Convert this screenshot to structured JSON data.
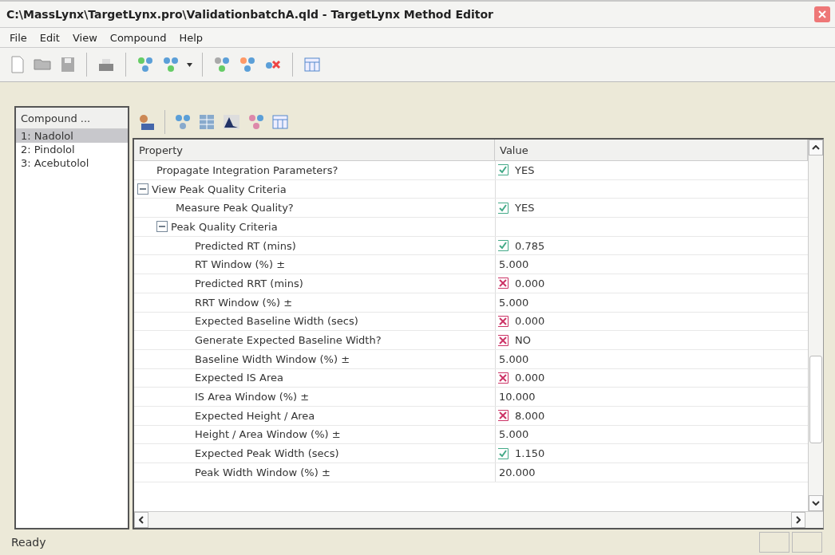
{
  "window": {
    "title": "C:\\MassLynx\\TargetLynx.pro\\ValidationbatchA.qld - TargetLynx Method Editor"
  },
  "menu": [
    "File",
    "Edit",
    "View",
    "Compound",
    "Help"
  ],
  "compounds": {
    "header": "Compound ...",
    "items": [
      {
        "label": "1: Nadolol",
        "selected": true
      },
      {
        "label": "2: Pindolol",
        "selected": false
      },
      {
        "label": "3: Acebutolol",
        "selected": false
      }
    ]
  },
  "grid": {
    "columns": [
      "Property",
      "Value"
    ],
    "rows": [
      {
        "label": "Propagate Integration Parameters?",
        "kind": "toggle",
        "enabled": true,
        "value": "YES"
      },
      {
        "label": "View Peak Quality Criteria",
        "kind": "group",
        "expanded": true,
        "children": [
          {
            "label": "Measure Peak Quality?",
            "kind": "toggle",
            "enabled": true,
            "value": "YES"
          },
          {
            "label": "Peak Quality Criteria",
            "kind": "group",
            "expanded": true,
            "children": [
              {
                "label": "Predicted RT (mins)",
                "kind": "toggle",
                "enabled": true,
                "value": "0.785"
              },
              {
                "label": "RT Window (%) ±",
                "kind": "plain",
                "value": "5.000"
              },
              {
                "label": "Predicted RRT (mins)",
                "kind": "toggle",
                "enabled": false,
                "value": "0.000"
              },
              {
                "label": "RRT Window (%) ±",
                "kind": "plain",
                "value": "5.000"
              },
              {
                "label": "Expected Baseline Width (secs)",
                "kind": "toggle",
                "enabled": false,
                "value": "0.000"
              },
              {
                "label": "Generate Expected Baseline Width?",
                "kind": "toggle",
                "enabled": false,
                "value": "NO"
              },
              {
                "label": "Baseline Width Window (%) ±",
                "kind": "plain",
                "value": "5.000"
              },
              {
                "label": "Expected IS Area",
                "kind": "toggle",
                "enabled": false,
                "value": "0.000"
              },
              {
                "label": "IS Area Window (%) ±",
                "kind": "plain",
                "value": "10.000"
              },
              {
                "label": "Expected Height / Area",
                "kind": "toggle",
                "enabled": false,
                "value": "8.000"
              },
              {
                "label": "Height / Area Window (%) ±",
                "kind": "plain",
                "value": "5.000"
              },
              {
                "label": "Expected Peak Width (secs)",
                "kind": "toggle",
                "enabled": true,
                "value": "1.150"
              },
              {
                "label": "Peak Width Window (%) ±",
                "kind": "plain",
                "value": "20.000"
              }
            ]
          }
        ]
      }
    ]
  },
  "status_bar": "Ready"
}
